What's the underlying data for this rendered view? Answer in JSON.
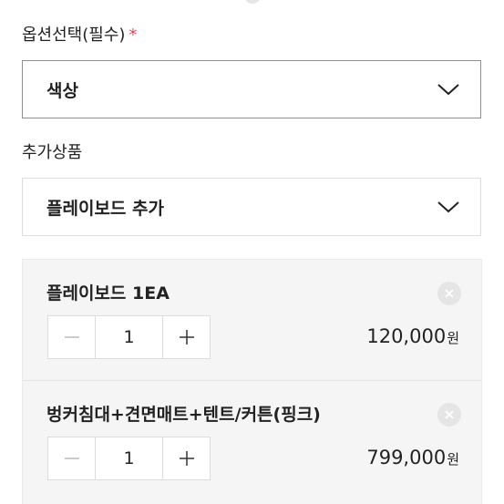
{
  "options": {
    "label": "옵션선택(필수)",
    "required_mark": "*",
    "selected_value": "색상"
  },
  "addons": {
    "label": "추가상품",
    "selected_value": "플레이보드 추가"
  },
  "selected_items": [
    {
      "name": "플레이보드 1EA",
      "quantity": "1",
      "price": "120,000",
      "currency": "원"
    },
    {
      "name": "벙커침대+견면매트+텐트/커튼(핑크)",
      "quantity": "1",
      "price": "799,000",
      "currency": "원"
    }
  ],
  "colors": {
    "required": "#e8425a",
    "panel_bg": "#f5f5f5"
  }
}
